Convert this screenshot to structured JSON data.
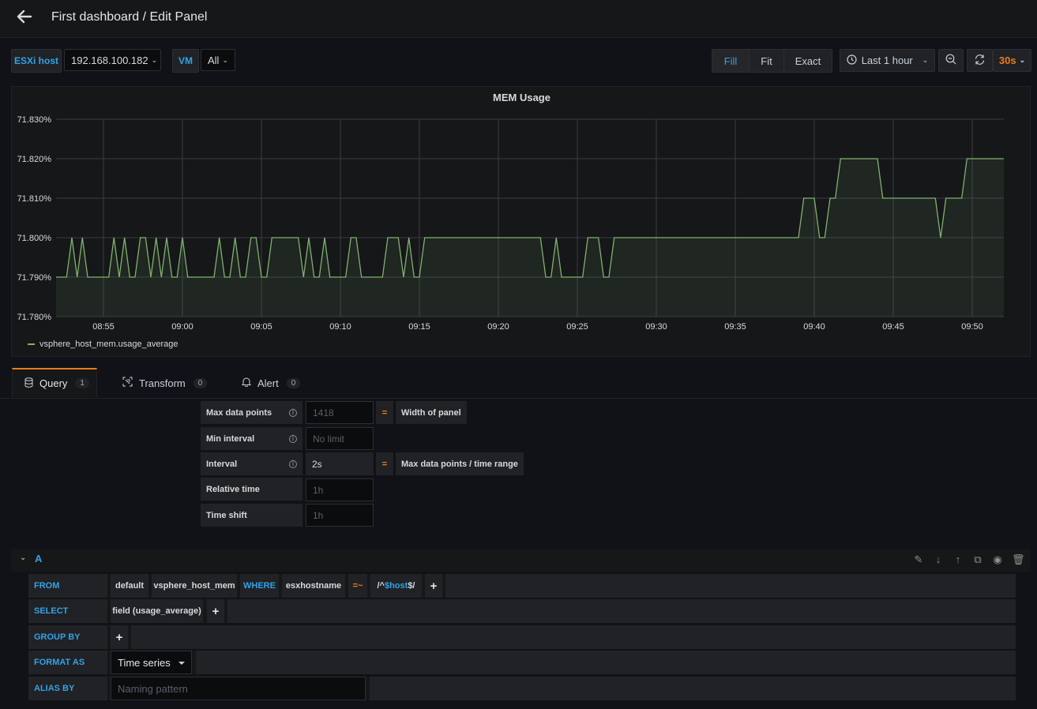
{
  "header": {
    "title": "First dashboard / Edit Panel"
  },
  "variables": [
    {
      "label": "ESXi host",
      "value": "192.168.100.182"
    },
    {
      "label": "VM",
      "value": "All"
    }
  ],
  "toolbar": {
    "fill": "Fill",
    "fit": "Fit",
    "exact": "Exact",
    "time_range": "Last 1 hour",
    "refresh": "30s"
  },
  "colors": {
    "accent": "#33a2e5",
    "series": "#7eb26d",
    "orange": "#eb7b18"
  },
  "panel": {
    "title": "MEM Usage",
    "legend": "vsphere_host_mem.usage_average"
  },
  "chart_data": {
    "type": "area",
    "title": "MEM Usage",
    "y_ticks": [
      "71.830%",
      "71.820%",
      "71.810%",
      "71.800%",
      "71.790%",
      "71.780%"
    ],
    "x_ticks": [
      "08:55",
      "09:00",
      "09:05",
      "09:10",
      "09:15",
      "09:20",
      "09:25",
      "09:30",
      "09:35",
      "09:40",
      "09:45",
      "09:50"
    ],
    "ylim": [
      71.78,
      71.83
    ],
    "grid": true,
    "legend_position": "bottom-left",
    "series": [
      {
        "name": "vsphere_host_mem.usage_average",
        "points": [
          [
            "08:52:00",
            71.79
          ],
          [
            "08:52:40",
            71.79
          ],
          [
            "08:53:00",
            71.8
          ],
          [
            "08:53:20",
            71.79
          ],
          [
            "08:53:40",
            71.8
          ],
          [
            "08:54:00",
            71.79
          ],
          [
            "08:55:20",
            71.79
          ],
          [
            "08:55:40",
            71.8
          ],
          [
            "08:56:00",
            71.79
          ],
          [
            "08:56:20",
            71.8
          ],
          [
            "08:56:40",
            71.79
          ],
          [
            "08:57:00",
            71.79
          ],
          [
            "08:57:20",
            71.8
          ],
          [
            "08:57:40",
            71.8
          ],
          [
            "08:58:00",
            71.79
          ],
          [
            "08:58:20",
            71.8
          ],
          [
            "08:58:40",
            71.79
          ],
          [
            "08:59:00",
            71.8
          ],
          [
            "08:59:20",
            71.79
          ],
          [
            "08:59:40",
            71.79
          ],
          [
            "09:00:00",
            71.8
          ],
          [
            "09:00:20",
            71.79
          ],
          [
            "09:02:00",
            71.79
          ],
          [
            "09:02:20",
            71.8
          ],
          [
            "09:02:40",
            71.79
          ],
          [
            "09:03:00",
            71.79
          ],
          [
            "09:03:20",
            71.8
          ],
          [
            "09:03:40",
            71.79
          ],
          [
            "09:04:00",
            71.79
          ],
          [
            "09:04:20",
            71.8
          ],
          [
            "09:04:40",
            71.8
          ],
          [
            "09:05:00",
            71.79
          ],
          [
            "09:05:20",
            71.79
          ],
          [
            "09:05:40",
            71.8
          ],
          [
            "09:07:20",
            71.8
          ],
          [
            "09:07:40",
            71.79
          ],
          [
            "09:08:00",
            71.8
          ],
          [
            "09:08:20",
            71.79
          ],
          [
            "09:08:40",
            71.79
          ],
          [
            "09:09:00",
            71.8
          ],
          [
            "09:09:20",
            71.79
          ],
          [
            "09:10:20",
            71.79
          ],
          [
            "09:10:40",
            71.8
          ],
          [
            "09:11:00",
            71.8
          ],
          [
            "09:11:20",
            71.79
          ],
          [
            "09:12:40",
            71.79
          ],
          [
            "09:13:00",
            71.8
          ],
          [
            "09:13:40",
            71.8
          ],
          [
            "09:14:00",
            71.79
          ],
          [
            "09:14:20",
            71.8
          ],
          [
            "09:14:40",
            71.79
          ],
          [
            "09:15:00",
            71.79
          ],
          [
            "09:15:20",
            71.8
          ],
          [
            "09:18:40",
            71.8
          ],
          [
            "09:19:00",
            71.8
          ],
          [
            "09:22:40",
            71.8
          ],
          [
            "09:23:00",
            71.79
          ],
          [
            "09:23:20",
            71.79
          ],
          [
            "09:23:40",
            71.8
          ],
          [
            "09:24:00",
            71.79
          ],
          [
            "09:25:20",
            71.79
          ],
          [
            "09:25:40",
            71.8
          ],
          [
            "09:26:20",
            71.8
          ],
          [
            "09:26:40",
            71.79
          ],
          [
            "09:27:00",
            71.79
          ],
          [
            "09:27:20",
            71.8
          ],
          [
            "09:39:00",
            71.8
          ],
          [
            "09:39:20",
            71.81
          ],
          [
            "09:40:00",
            71.81
          ],
          [
            "09:40:20",
            71.8
          ],
          [
            "09:40:40",
            71.8
          ],
          [
            "09:41:00",
            71.81
          ],
          [
            "09:41:20",
            71.81
          ],
          [
            "09:41:40",
            71.82
          ],
          [
            "09:44:00",
            71.82
          ],
          [
            "09:44:20",
            71.81
          ],
          [
            "09:47:40",
            71.81
          ],
          [
            "09:48:00",
            71.8
          ],
          [
            "09:48:20",
            71.81
          ],
          [
            "09:49:20",
            71.81
          ],
          [
            "09:49:40",
            71.82
          ],
          [
            "09:52:00",
            71.82
          ]
        ]
      }
    ]
  },
  "tabs": [
    {
      "label": "Query",
      "count": "1"
    },
    {
      "label": "Transform",
      "count": "0"
    },
    {
      "label": "Alert",
      "count": "0"
    }
  ],
  "query_options": {
    "max_data_points": {
      "label": "Max data points",
      "placeholder": "1418",
      "eq": "=",
      "note": "Width of panel"
    },
    "min_interval": {
      "label": "Min interval",
      "placeholder": "No limit"
    },
    "interval": {
      "label": "Interval",
      "value": "2s",
      "eq": "=",
      "note": "Max data points / time range"
    },
    "relative_time": {
      "label": "Relative time",
      "placeholder": "1h"
    },
    "time_shift": {
      "label": "Time shift",
      "placeholder": "1h"
    }
  },
  "query": {
    "letter": "A",
    "from": {
      "keyword": "FROM",
      "policy": "default",
      "measurement": "vsphere_host_mem",
      "where": "WHERE",
      "tag": "esxhostname",
      "op": "=~",
      "value_prefix": "/^",
      "value_var": "$host",
      "value_suffix": "$/"
    },
    "select": {
      "keyword": "SELECT",
      "field": "field (usage_average)"
    },
    "group_by": {
      "keyword": "GROUP BY"
    },
    "format_as": {
      "keyword": "FORMAT AS",
      "value": "Time series"
    },
    "alias_by": {
      "keyword": "ALIAS BY",
      "placeholder": "Naming pattern"
    },
    "plus": "+"
  }
}
